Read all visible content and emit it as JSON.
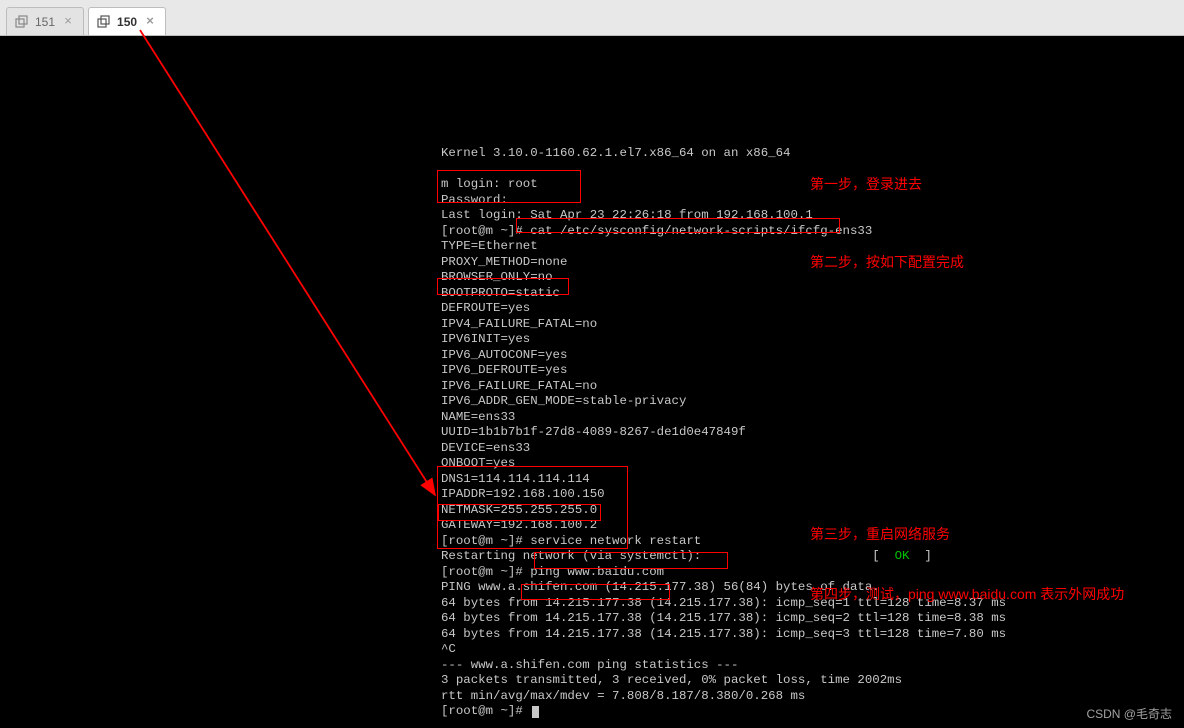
{
  "tabs": [
    {
      "label": "151",
      "active": false
    },
    {
      "label": "150",
      "active": true
    }
  ],
  "annotations": {
    "step1": "第一步，登录进去",
    "step2": "第二步，按如下配置完成",
    "step3": "第三步，重启网络服务",
    "step4": "第四步，测试，ping www.baidu.com 表示外网成功"
  },
  "ok_label": "OK",
  "terminal_lines": [
    "Kernel 3.10.0-1160.62.1.el7.x86_64 on an x86_64",
    "",
    "m login: root",
    "Password:",
    "Last login: Sat Apr 23 22:26:18 from 192.168.100.1",
    "[root@m ~]# cat /etc/sysconfig/network-scripts/ifcfg-ens33",
    "TYPE=Ethernet",
    "PROXY_METHOD=none",
    "BROWSER_ONLY=no",
    "BOOTPROTO=static",
    "DEFROUTE=yes",
    "IPV4_FAILURE_FATAL=no",
    "IPV6INIT=yes",
    "IPV6_AUTOCONF=yes",
    "IPV6_DEFROUTE=yes",
    "IPV6_FAILURE_FATAL=no",
    "IPV6_ADDR_GEN_MODE=stable-privacy",
    "NAME=ens33",
    "UUID=1b1b7b1f-27d8-4089-8267-de1d0e47849f",
    "DEVICE=ens33",
    "ONBOOT=yes",
    "DNS1=114.114.114.114",
    "IPADDR=192.168.100.150",
    "NETMASK=255.255.255.0",
    "GATEWAY=192.168.100.2",
    "[root@m ~]# service network restart",
    "Restarting network (via systemctl):                       [  OK  ]",
    "[root@m ~]# ping www.baidu.com",
    "PING www.a.shifen.com (14.215.177.38) 56(84) bytes of data.",
    "64 bytes from 14.215.177.38 (14.215.177.38): icmp_seq=1 ttl=128 time=8.37 ms",
    "64 bytes from 14.215.177.38 (14.215.177.38): icmp_seq=2 ttl=128 time=8.38 ms",
    "64 bytes from 14.215.177.38 (14.215.177.38): icmp_seq=3 ttl=128 time=7.80 ms",
    "^C",
    "--- www.a.shifen.com ping statistics ---",
    "3 packets transmitted, 3 received, 0% packet loss, time 2002ms",
    "rtt min/avg/max/mdev = 7.808/8.187/8.380/0.268 ms",
    "[root@m ~]# "
  ],
  "watermark": "CSDN @毛奇志"
}
